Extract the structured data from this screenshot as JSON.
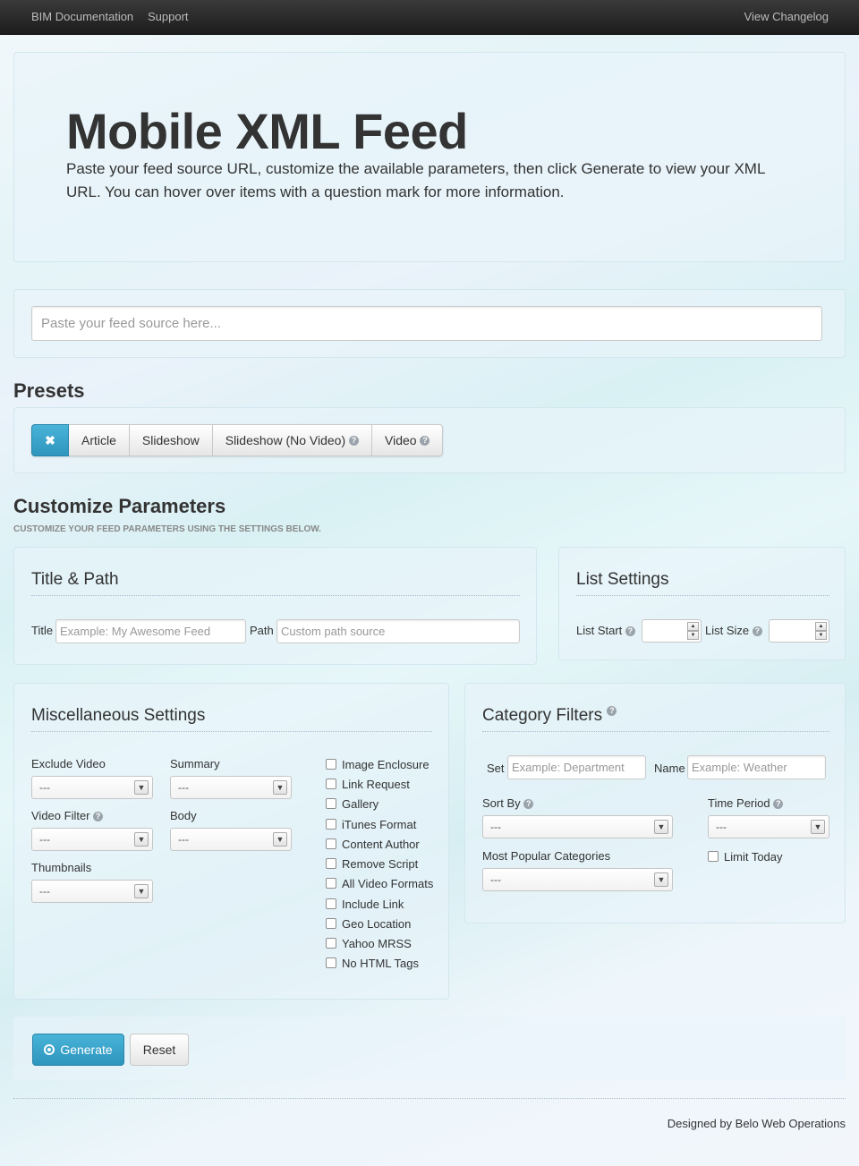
{
  "navbar": {
    "links": [
      "BIM Documentation",
      "Support"
    ],
    "changelog": "View Changelog"
  },
  "hero": {
    "title": "Mobile XML Feed",
    "lead": "Paste your feed source URL, customize the available parameters, then click Generate to view your XML URL. You can hover over items with a question mark for more information."
  },
  "feed_source": {
    "placeholder": "Paste your feed source here..."
  },
  "presets": {
    "heading": "Presets",
    "clear_icon": "x-icon",
    "buttons": [
      "Article",
      "Slideshow",
      "Slideshow (No Video)",
      "Video"
    ]
  },
  "customize": {
    "heading": "Customize Parameters",
    "subheading": "CUSTOMIZE YOUR FEED PARAMETERS USING THE SETTINGS BELOW."
  },
  "title_path": {
    "heading": "Title & Path",
    "title_label": "Title",
    "title_placeholder": "Example: My Awesome Feed",
    "path_label": "Path",
    "path_placeholder": "Custom path source"
  },
  "list_settings": {
    "heading": "List Settings",
    "list_start_label": "List Start",
    "list_size_label": "List Size"
  },
  "misc": {
    "heading": "Miscellaneous Settings",
    "exclude_video_label": "Exclude Video",
    "exclude_video_value": "---",
    "summary_label": "Summary",
    "summary_value": "---",
    "video_filter_label": "Video Filter",
    "video_filter_value": "---",
    "body_label": "Body",
    "body_value": "---",
    "thumbnails_label": "Thumbnails",
    "thumbnails_value": "---",
    "checkboxes": [
      "Image Enclosure",
      "Link Request",
      "Gallery",
      "iTunes Format",
      "Content Author",
      "Remove Script",
      "All Video Formats",
      "Include Link",
      "Geo Location",
      "Yahoo MRSS",
      "No HTML Tags"
    ]
  },
  "category": {
    "heading": "Category Filters",
    "set_label": "Set",
    "set_placeholder": "Example: Department",
    "name_label": "Name",
    "name_placeholder": "Example: Weather",
    "sort_by_label": "Sort By",
    "sort_by_value": "---",
    "time_period_label": "Time Period",
    "time_period_value": "---",
    "most_popular_label": "Most Popular Categories",
    "most_popular_value": "---",
    "limit_today_label": "Limit Today"
  },
  "actions": {
    "generate": "Generate",
    "reset": "Reset"
  },
  "footer": {
    "credit": "Designed by Belo Web Operations"
  }
}
